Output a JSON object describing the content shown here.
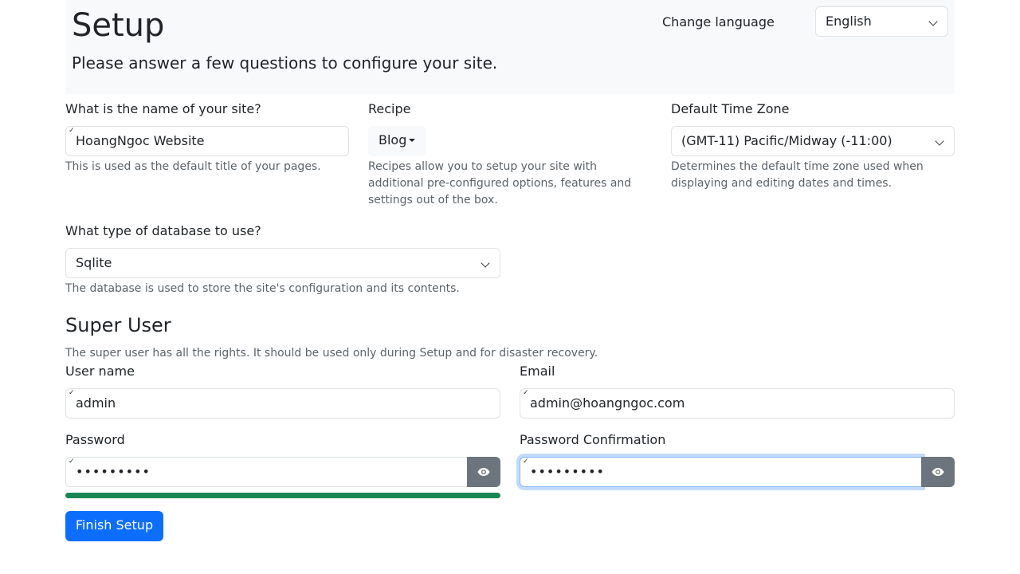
{
  "header": {
    "title": "Setup",
    "subtitle": "Please answer a few questions to configure your site.",
    "change_language_label": "Change language",
    "language_selected": "English"
  },
  "site": {
    "name_label": "What is the name of your site?",
    "name_value": "HoangNgoc Website",
    "name_help": "This is used as the default title of your pages."
  },
  "recipe": {
    "label": "Recipe",
    "selected": "Blog",
    "help": "Recipes allow you to setup your site with additional pre-configured options, features and settings out of the box."
  },
  "timezone": {
    "label": "Default Time Zone",
    "selected": "(GMT-11) Pacific/Midway (-11:00)",
    "help": "Determines the default time zone used when displaying and editing dates and times."
  },
  "database": {
    "label": "What type of database to use?",
    "selected": "Sqlite",
    "help": "The database is used to store the site's configuration and its contents."
  },
  "super_user": {
    "title": "Super User",
    "help": "The super user has all the rights. It should be used only during Setup and for disaster recovery.",
    "username_label": "User name",
    "username_value": "admin",
    "email_label": "Email",
    "email_value": "admin@hoangngoc.com",
    "password_label": "Password",
    "password_value": "•••••••••",
    "password_confirm_label": "Password Confirmation",
    "password_confirm_value": "•••••••••",
    "password_strength_percent": 100
  },
  "actions": {
    "finish_label": "Finish Setup"
  },
  "colors": {
    "primary": "#0d6efd",
    "success": "#198754",
    "secondary": "#6c757d",
    "header_bg": "#f8f9fa"
  }
}
